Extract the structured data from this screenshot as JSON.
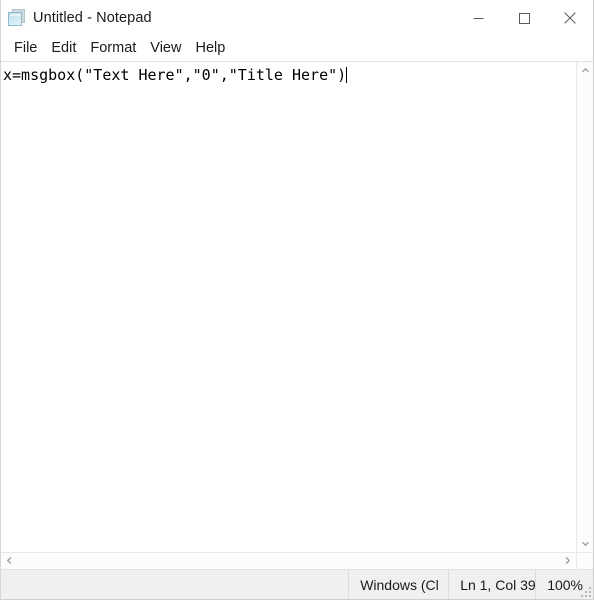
{
  "window": {
    "title": "Untitled - Notepad",
    "app_icon": "notepad-icon",
    "controls": {
      "minimize": "minimize-icon",
      "maximize": "maximize-icon",
      "close": "close-icon"
    }
  },
  "menubar": {
    "items": [
      {
        "label": "File"
      },
      {
        "label": "Edit"
      },
      {
        "label": "Format"
      },
      {
        "label": "View"
      },
      {
        "label": "Help"
      }
    ]
  },
  "editor": {
    "text": "x=msgbox(\"Text Here\",\"0\",\"Title Here\")",
    "placeholder": "",
    "caret_visible": true
  },
  "scrollbars": {
    "vertical": {
      "up_arrow": "chevron-up-icon",
      "down_arrow": "chevron-down-icon"
    },
    "horizontal": {
      "left_arrow": "chevron-left-icon",
      "right_arrow": "chevron-right-icon"
    }
  },
  "statusbar": {
    "encoding": "Windows (Cl",
    "position": "Ln 1, Col 39",
    "zoom": "100%"
  },
  "colors": {
    "window_bg": "#ffffff",
    "statusbar_bg": "#f0f0f0",
    "text": "#000000",
    "border": "#e2e2e2",
    "close_hover": "#e81123"
  }
}
